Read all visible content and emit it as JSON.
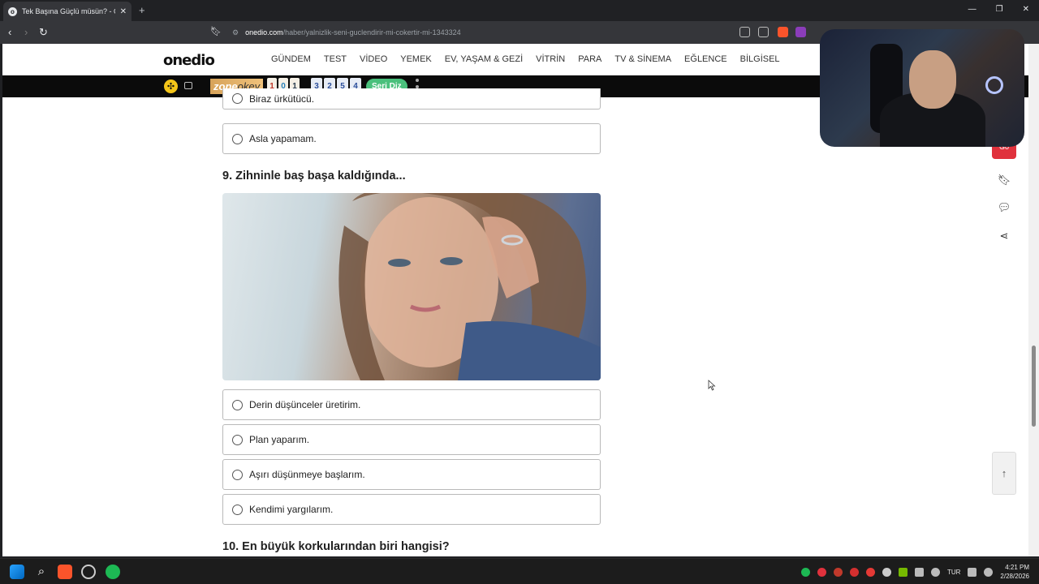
{
  "browser": {
    "tab_title": "Tek Başına Güçlü müsün? - One",
    "tab_favicon": "o",
    "url_domain": "onedio.com",
    "url_path": "/haber/yalnizlik-seni-guclendirir-mi-cokertir-mi-1343324"
  },
  "site": {
    "logo": "onedio",
    "nav": [
      "GÜNDEM",
      "TEST",
      "VİDEO",
      "YEMEK",
      "EV, YAŞAM & GEZİ",
      "VİTRİN",
      "PARA",
      "TV & SİNEMA",
      "EĞLENCE",
      "BİLGİSEL"
    ]
  },
  "ad": {
    "zone_a": "zone",
    "zone_b": "okey",
    "tiles": [
      "1",
      "0",
      "1"
    ],
    "numbers": [
      "3",
      "2",
      "5",
      "4"
    ],
    "button": "Seri Diz"
  },
  "quiz": {
    "prev_options": [
      "Biraz ürkütücü.",
      "Asla yapamam."
    ],
    "q9": {
      "title": "9. Zihninle baş başa kaldığında...",
      "options": [
        "Derin düşünceler üretirim.",
        "Plan yaparım.",
        "Aşırı düşünmeye başlarım.",
        "Kendimi yargılarım."
      ]
    },
    "q10": {
      "title": "10. En büyük korkularından biri hangisi?"
    }
  },
  "tools": {
    "red_label": "Gö"
  },
  "taskbar": {
    "lang": "TUR",
    "time": "4:21 PM",
    "date": "2/28/2026"
  },
  "colors": {
    "accent_red": "#e0313c",
    "seri_green": "#4ac07c",
    "zone_gold": "#d7a35a"
  }
}
